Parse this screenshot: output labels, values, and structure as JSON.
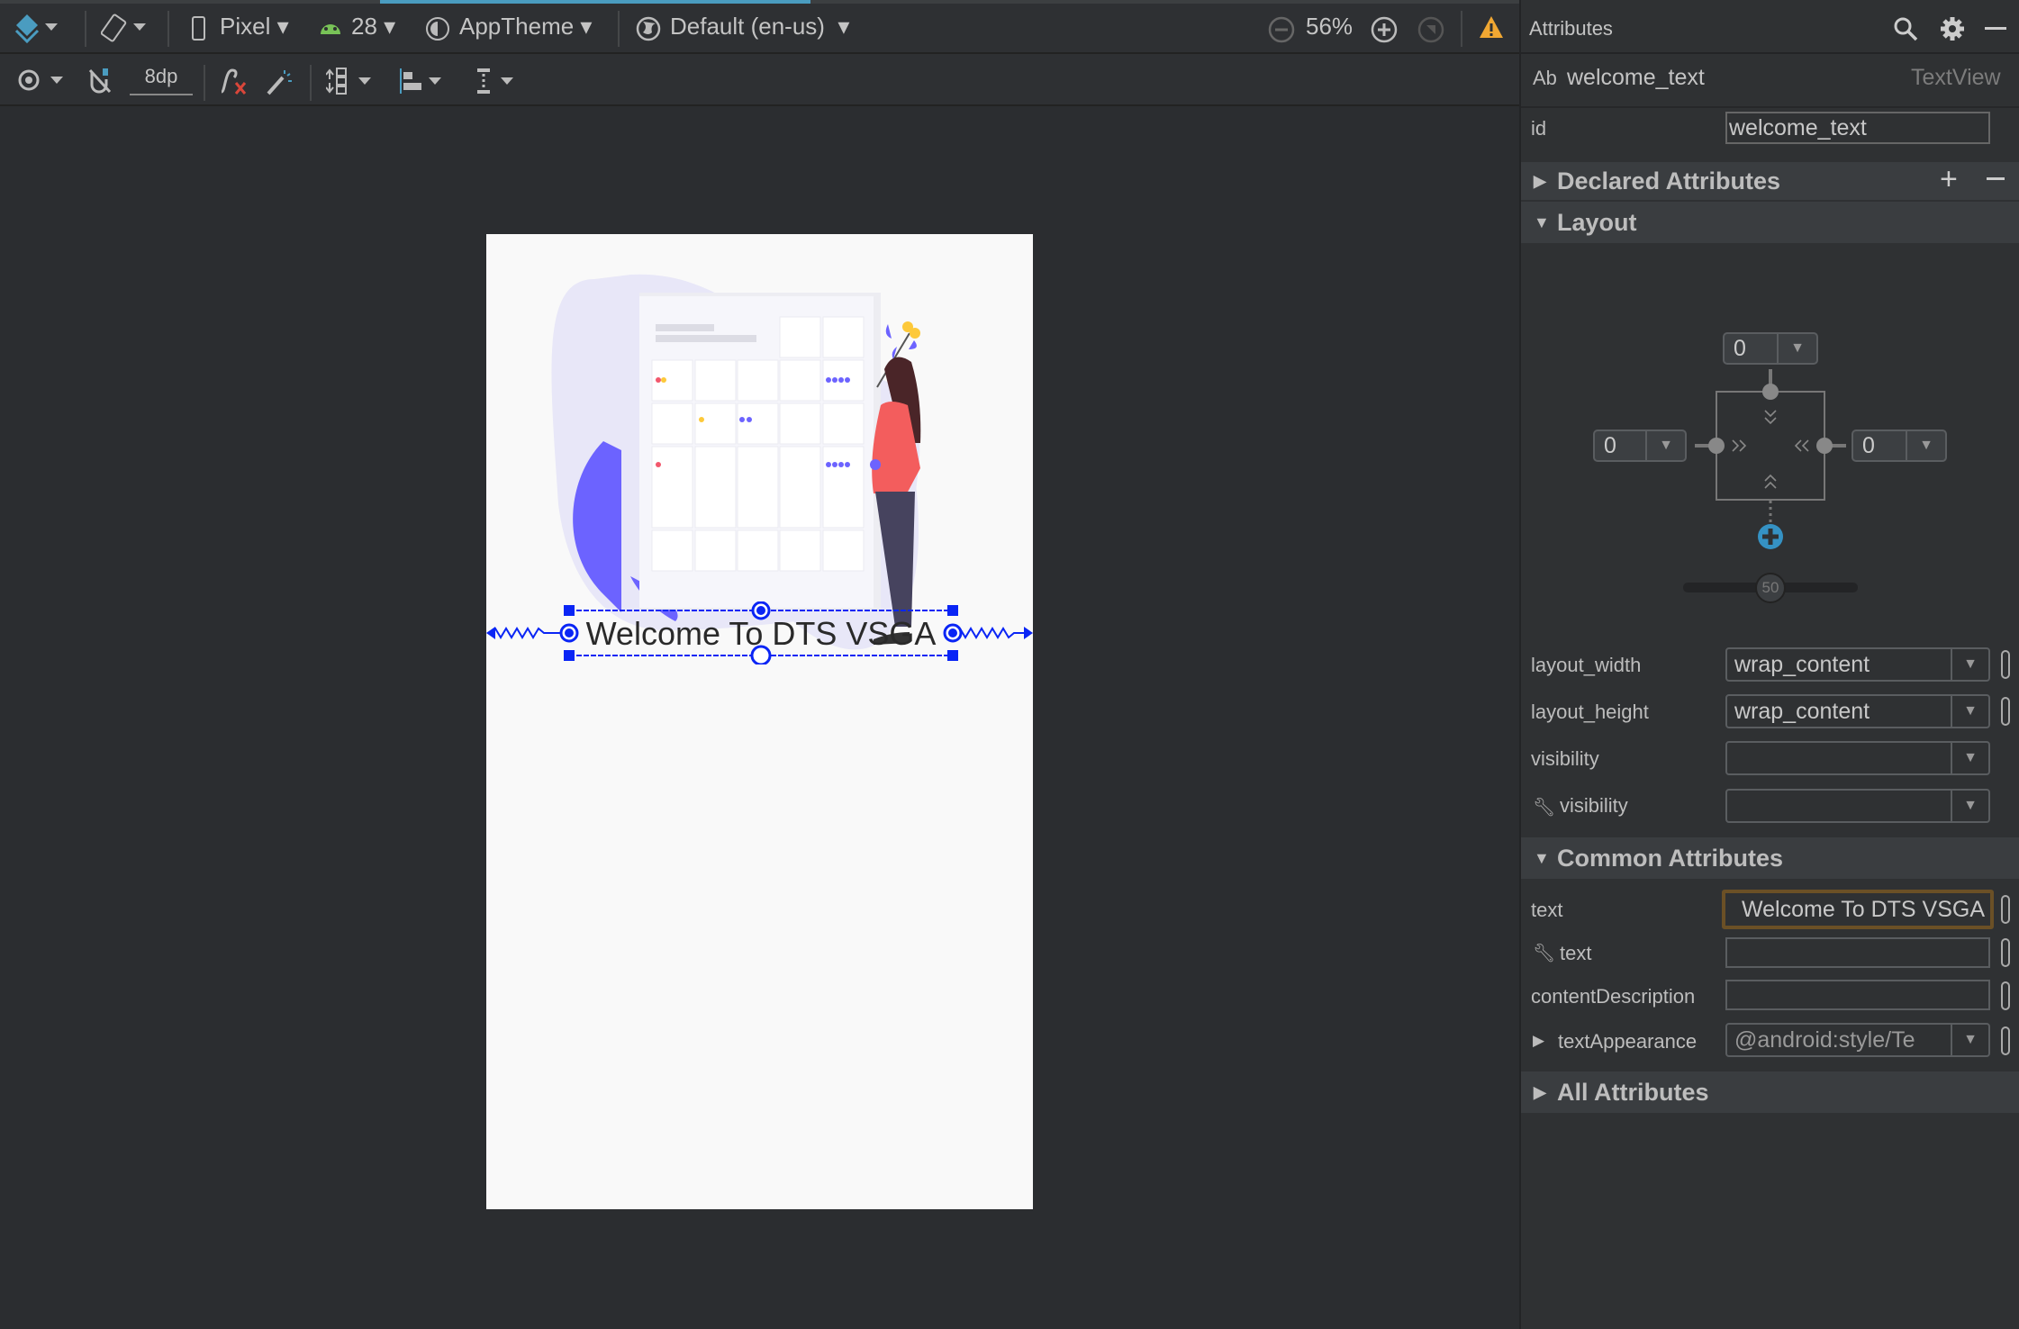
{
  "toolbar": {
    "device": "Pixel",
    "api": "28",
    "theme": "AppTheme",
    "locale": "Default (en-us)",
    "zoom": "56%",
    "margin": "8dp"
  },
  "attributes": {
    "title": "Attributes",
    "component_prefix": "Ab",
    "component_id": "welcome_text",
    "component_type": "TextView",
    "id_label": "id",
    "id_value": "welcome_text",
    "sections": {
      "declared": "Declared Attributes",
      "layout": "Layout",
      "common": "Common Attributes",
      "all": "All Attributes"
    },
    "constraints": {
      "top": "0",
      "left": "0",
      "right": "0",
      "bias": "50"
    },
    "layout_rows": [
      {
        "label": "layout_width",
        "value": "wrap_content"
      },
      {
        "label": "layout_height",
        "value": "wrap_content"
      },
      {
        "label": "visibility",
        "value": ""
      },
      {
        "label": "visibility",
        "value": ""
      }
    ],
    "common_rows": [
      {
        "label": "text",
        "value": "Welcome To DTS VSGA"
      },
      {
        "label": "text",
        "value": ""
      },
      {
        "label": "contentDescription",
        "value": ""
      },
      {
        "label": "textAppearance",
        "value": "@android:style/Te"
      }
    ]
  },
  "preview": {
    "welcome_text": "Welcome To DTS VSGA"
  },
  "colors": {
    "accent": "#4a9cc0",
    "selection": "#0a25f5",
    "warning": "#f0a732",
    "illustration": "#6c63ff"
  }
}
